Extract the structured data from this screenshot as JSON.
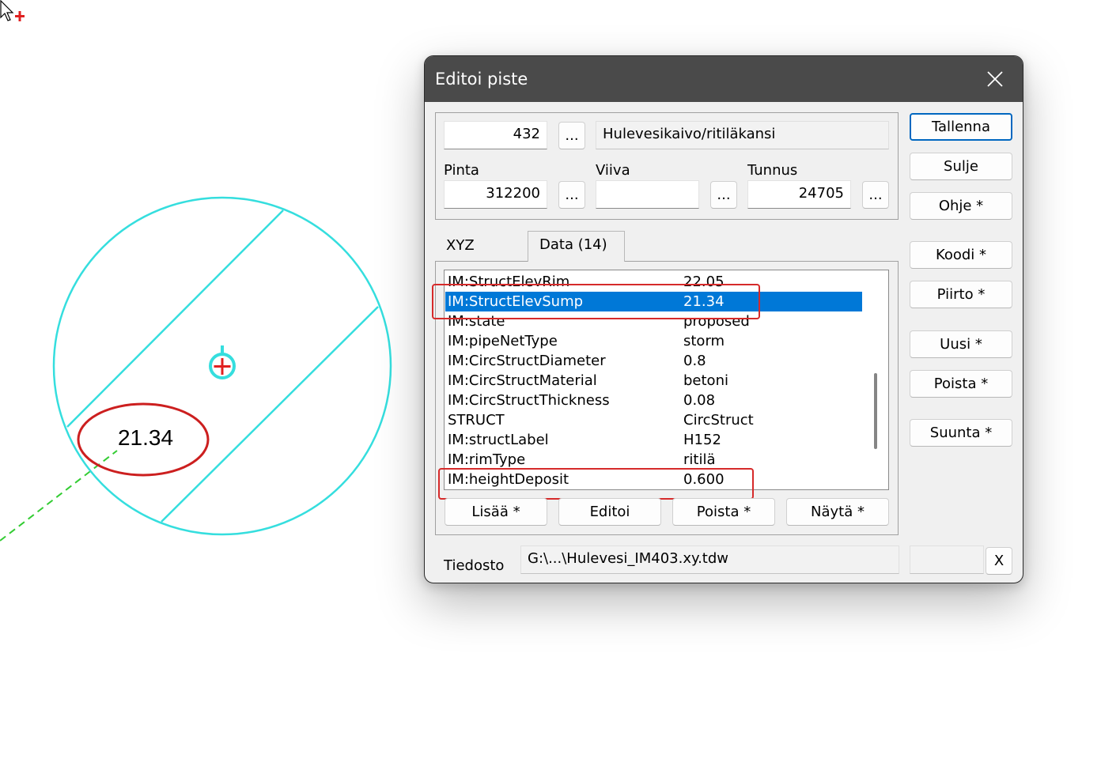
{
  "drawing": {
    "elevation_label": "21.34"
  },
  "dialog": {
    "title": "Editoi piste",
    "point": {
      "number": "432",
      "code_name": "Hulevesikaivo/ritiläkansi",
      "pinta_label": "Pinta",
      "pinta_value": "312200",
      "viiva_label": "Viiva",
      "viiva_value": "",
      "tunnus_label": "Tunnus",
      "tunnus_value": "24705",
      "browse_label": "..."
    },
    "tabs": [
      {
        "label": "XYZ",
        "active": false
      },
      {
        "label": "Data (14)",
        "active": true
      }
    ],
    "data_rows": [
      {
        "key": "IM:StructElevRim",
        "value": "22.05"
      },
      {
        "key": "IM:StructElevSump",
        "value": "21.34",
        "selected": true
      },
      {
        "key": "IM:state",
        "value": "proposed"
      },
      {
        "key": "IM:pipeNetType",
        "value": "storm"
      },
      {
        "key": "IM:CircStructDiameter",
        "value": "0.8"
      },
      {
        "key": "IM:CircStructMaterial",
        "value": "betoni"
      },
      {
        "key": "IM:CircStructThickness",
        "value": "0.08"
      },
      {
        "key": "STRUCT",
        "value": "CircStruct"
      },
      {
        "key": "IM:structLabel",
        "value": "H152"
      },
      {
        "key": "IM:rimType",
        "value": "ritilä"
      },
      {
        "key": "IM:heightDeposit",
        "value": "0.600"
      }
    ],
    "data_buttons": {
      "add": "Lisää  *",
      "edit": "Editoi",
      "remove": "Poista  *",
      "show": "Näytä  *"
    },
    "side_buttons": {
      "save": "Tallenna",
      "close": "Sulje",
      "help": "Ohje  *",
      "code": "Koodi  *",
      "draw": "Piirto  *",
      "new": "Uusi  *",
      "delete": "Poista  *",
      "direction": "Suunta  *"
    },
    "file": {
      "label": "Tiedosto",
      "path": "G:\\...\\Hulevesi_IM403.xy.tdw",
      "clear": "X"
    }
  },
  "colors": {
    "title_bar": "#4a4a4a",
    "selection": "#0078d7",
    "annotation": "#d62a2a",
    "manhole_outline": "#35dede",
    "pipe_line": "#33cc33"
  }
}
